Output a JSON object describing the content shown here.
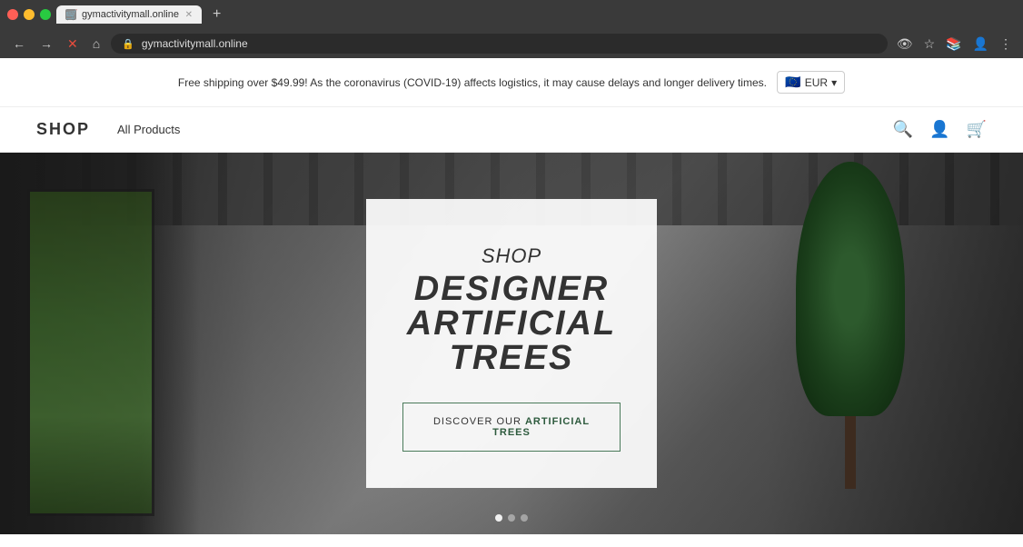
{
  "browser": {
    "tabs": [
      {
        "id": "tab1",
        "label": "gymactivitymall.online",
        "active": true,
        "favicon": "🛒"
      }
    ],
    "address": "gymactivitymall.online",
    "new_tab_label": "+",
    "nav": {
      "back": "←",
      "forward": "→",
      "reload": "✕",
      "home": "⌂"
    }
  },
  "website": {
    "announcement": {
      "text": "Free shipping over $49.99! As the coronavirus (COVID-19) affects logistics, it may cause delays and longer delivery times.",
      "currency_label": "EUR",
      "currency_flag": "🇪🇺"
    },
    "nav": {
      "logo": "SHOP",
      "links": [
        {
          "label": "All Products"
        }
      ],
      "icons": {
        "search": "🔍",
        "account": "👤",
        "cart": "🛒"
      }
    },
    "hero": {
      "card": {
        "top_line": "SHOP",
        "main_line1": "DESIGNER",
        "main_line2": "ARTIFICIAL",
        "main_line3": "TREES",
        "button_prefix": "DISCOVER OUR ",
        "button_highlight": "ARTIFICIAL TREES"
      },
      "dots": [
        true,
        false,
        false
      ]
    }
  }
}
